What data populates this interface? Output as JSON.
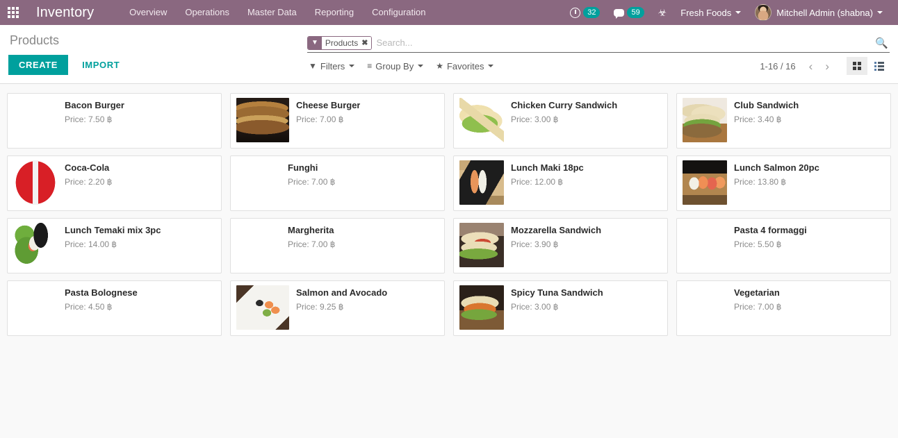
{
  "navbar": {
    "apps_icon": "grid-apps-icon",
    "brand": "Inventory",
    "menu": [
      {
        "label": "Overview"
      },
      {
        "label": "Operations"
      },
      {
        "label": "Master Data"
      },
      {
        "label": "Reporting"
      },
      {
        "label": "Configuration"
      }
    ],
    "activities": {
      "icon": "clock-icon",
      "count": "32"
    },
    "messages": {
      "icon": "chat-bubble-icon",
      "count": "59"
    },
    "debug": {
      "icon": "bug-icon",
      "glyph": "☣"
    },
    "company": "Fresh Foods",
    "user": "Mitchell Admin (shabna)",
    "accent": "#8a6880",
    "badge_color": "#00a09d"
  },
  "control_panel": {
    "breadcrumb": "Products",
    "create_label": "CREATE",
    "import_label": "IMPORT",
    "create_color": "#00a09d",
    "search": {
      "facet_icon": "filter-funnel-icon",
      "facet_label": "Products",
      "facet_remove": "✖",
      "placeholder": "Search...",
      "value": "",
      "magnifier_icon": "search-icon"
    },
    "filters": [
      {
        "name": "filters",
        "icon": "funnel-icon",
        "glyph": "▼",
        "label": "Filters"
      },
      {
        "name": "group-by",
        "icon": "hamburger-icon",
        "glyph": "≡",
        "label": "Group By"
      },
      {
        "name": "favorites",
        "icon": "star-icon",
        "glyph": "★",
        "label": "Favorites"
      }
    ],
    "pager": {
      "count": "1-16 / 16",
      "prev_icon": "chevron-left-icon",
      "prev_glyph": "‹",
      "next_icon": "chevron-right-icon",
      "next_glyph": "›"
    },
    "views": [
      {
        "name": "kanban-view",
        "icon": "kanban-icon",
        "active": true
      },
      {
        "name": "list-view",
        "icon": "list-icon",
        "active": false
      }
    ]
  },
  "products": {
    "price_prefix": "Price: ",
    "currency": "฿",
    "items": [
      {
        "name": "Bacon Burger",
        "price": "7.50",
        "image": "img-bacon-burger",
        "wide": false
      },
      {
        "name": "Cheese Burger",
        "price": "7.00",
        "image": "img-cheese-burger",
        "wide": true
      },
      {
        "name": "Chicken Curry Sandwich",
        "price": "3.00",
        "image": "img-chicken-curry",
        "wide": false
      },
      {
        "name": "Club Sandwich",
        "price": "3.40",
        "image": "img-club-sandwich",
        "wide": false
      },
      {
        "name": "Coca-Cola",
        "price": "2.20",
        "image": "img-coca-cola",
        "wide": false
      },
      {
        "name": "Funghi",
        "price": "7.00",
        "image": "img-pizza",
        "wide": false
      },
      {
        "name": "Lunch Maki 18pc",
        "price": "12.00",
        "image": "img-lunch-maki",
        "wide": false
      },
      {
        "name": "Lunch Salmon 20pc",
        "price": "13.80",
        "image": "img-lunch-salmon",
        "wide": false
      },
      {
        "name": "Lunch Temaki mix 3pc",
        "price": "14.00",
        "image": "img-temaki",
        "wide": false
      },
      {
        "name": "Margherita",
        "price": "7.00",
        "image": "img-pizza",
        "wide": false
      },
      {
        "name": "Mozzarella Sandwich",
        "price": "3.90",
        "image": "img-mozzarella",
        "wide": false
      },
      {
        "name": "Pasta 4 formaggi",
        "price": "5.50",
        "image": "img-pasta-4f",
        "wide": false
      },
      {
        "name": "Pasta Bolognese",
        "price": "4.50",
        "image": "img-pasta-bol",
        "wide": false
      },
      {
        "name": "Salmon and Avocado",
        "price": "9.25",
        "image": "img-salmon-avocado",
        "wide": true
      },
      {
        "name": "Spicy Tuna Sandwich",
        "price": "3.00",
        "image": "img-spicy-tuna",
        "wide": false
      },
      {
        "name": "Vegetarian",
        "price": "7.00",
        "image": "img-pizza",
        "wide": false
      }
    ]
  }
}
